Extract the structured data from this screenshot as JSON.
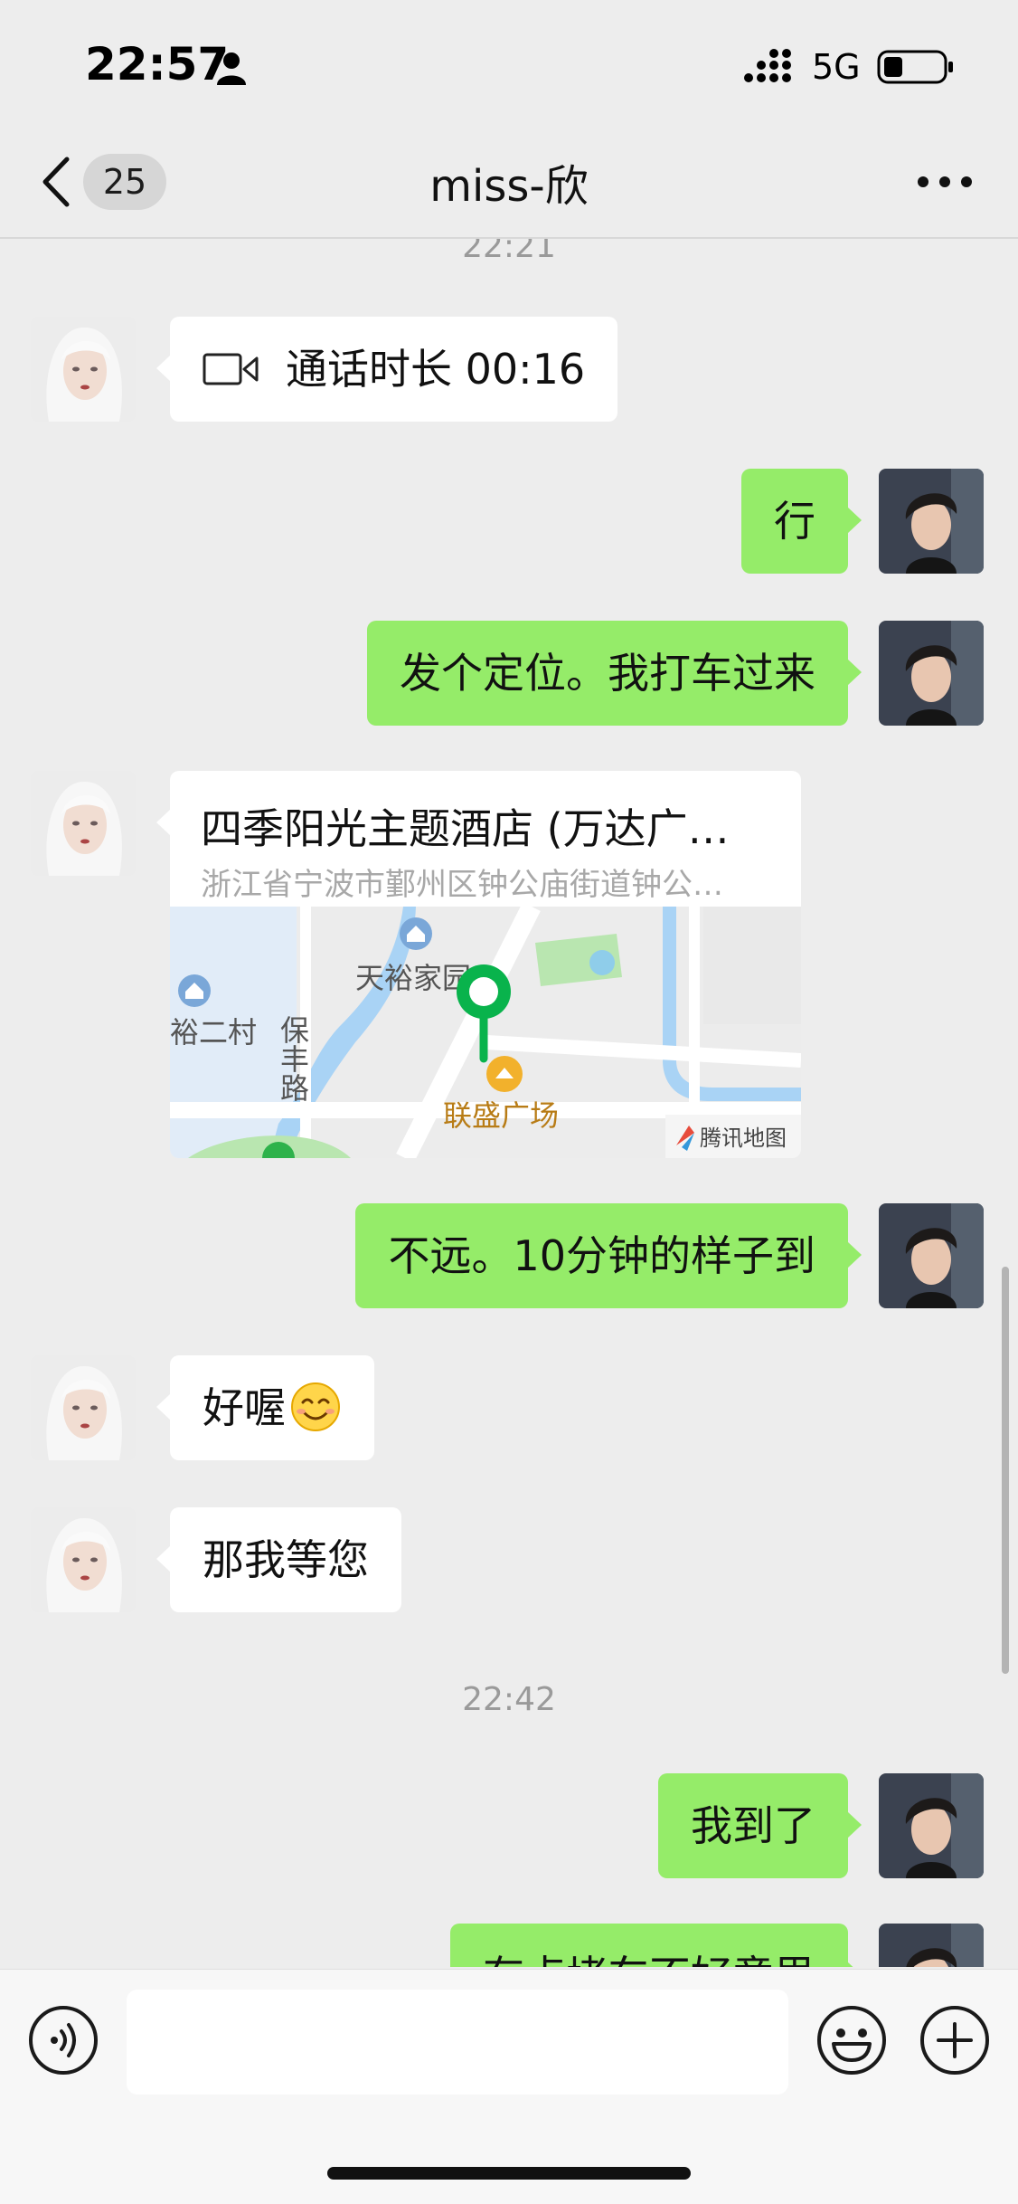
{
  "status_bar": {
    "time": "22:57",
    "network": "5G"
  },
  "nav": {
    "back_badge": "25",
    "title": "miss-欣"
  },
  "messages": {
    "timestamp_top": "22:21",
    "call": {
      "text": "通话时长 00:16"
    },
    "m1": "行",
    "m2": "发个定位。我打车过来",
    "location": {
      "title": "四季阳光主题酒店 (万达广…",
      "address": "浙江省宁波市鄞州区钟公庙街道钟公…",
      "map_labels": {
        "village": "裕二村",
        "estate": "天裕家园",
        "road": "保丰路",
        "plaza": "联盛广场",
        "provider": "腾讯地图"
      }
    },
    "m3": "不远。10分钟的样子到",
    "m4": "好喔",
    "m5": "那我等您",
    "timestamp_mid": "22:42",
    "m6": "我到了",
    "m7": "有点堵车不好意思"
  },
  "input": {
    "placeholder": ""
  },
  "colors": {
    "outgoing_bubble": "#95ec69",
    "incoming_bubble": "#ffffff",
    "background": "#ededed"
  }
}
